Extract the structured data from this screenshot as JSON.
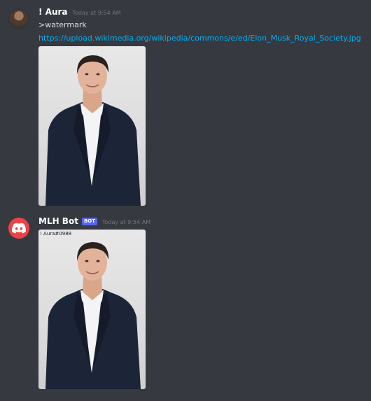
{
  "messages": [
    {
      "author": "! Aura",
      "timestamp": "Today at 9:54 AM",
      "avatar_icon": "user-avatar",
      "text": ">watermark",
      "link": "https://upload.wikimedia.org/wikipedia/commons/e/ed/Elon_Musk_Royal_Society.jpg",
      "image_alt": "portrait photo"
    },
    {
      "author": "MLH Bot",
      "bot_tag": "BOT",
      "timestamp": "Today at 9:54 AM",
      "avatar_icon": "discord-logo-icon",
      "image_watermark": "! Aura#0988",
      "image_alt": "watermarked portrait photo"
    }
  ],
  "colors": {
    "background": "#36393f",
    "username": "#ffffff",
    "timestamp": "#72767d",
    "link": "#00aff4",
    "bot_tag": "#5865f2",
    "bot_avatar": "#ed4245"
  }
}
